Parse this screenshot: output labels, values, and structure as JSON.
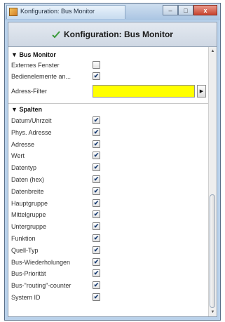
{
  "window": {
    "title": "Konfiguration: Bus Monitor",
    "buttons": {
      "minimize": "–",
      "maximize": "□",
      "close": "x"
    }
  },
  "header": {
    "title": "Konfiguration: Bus Monitor"
  },
  "sections": {
    "bus_monitor": {
      "label": "Bus Monitor",
      "external_window": {
        "label": "Externes Fenster",
        "checked": false
      },
      "controls": {
        "label": "Bedienelemente an...",
        "checked": true
      },
      "address_filter": {
        "label": "Adress-Filter",
        "value": "",
        "color": "#ffff00"
      }
    },
    "columns": {
      "label": "Spalten",
      "items": [
        {
          "label": "Datum/Uhrzeit",
          "checked": true
        },
        {
          "label": "Phys. Adresse",
          "checked": true
        },
        {
          "label": "Adresse",
          "checked": true
        },
        {
          "label": "Wert",
          "checked": true
        },
        {
          "label": "Datentyp",
          "checked": true
        },
        {
          "label": "Daten (hex)",
          "checked": true
        },
        {
          "label": "Datenbreite",
          "checked": true
        },
        {
          "label": "Hauptgruppe",
          "checked": true
        },
        {
          "label": "Mittelgruppe",
          "checked": true
        },
        {
          "label": "Untergruppe",
          "checked": true
        },
        {
          "label": "Funktion",
          "checked": true
        },
        {
          "label": "Quell-Typ",
          "checked": true
        },
        {
          "label": "Bus-Wiederholungen",
          "checked": true
        },
        {
          "label": "Bus-Priorität",
          "checked": true
        },
        {
          "label": "Bus-\"routing\"-counter",
          "checked": true
        },
        {
          "label": "System ID",
          "checked": true
        }
      ]
    }
  },
  "icons": {
    "section_toggle": "triangle-down",
    "go_button": "play-arrow",
    "checkmark": "✔"
  }
}
